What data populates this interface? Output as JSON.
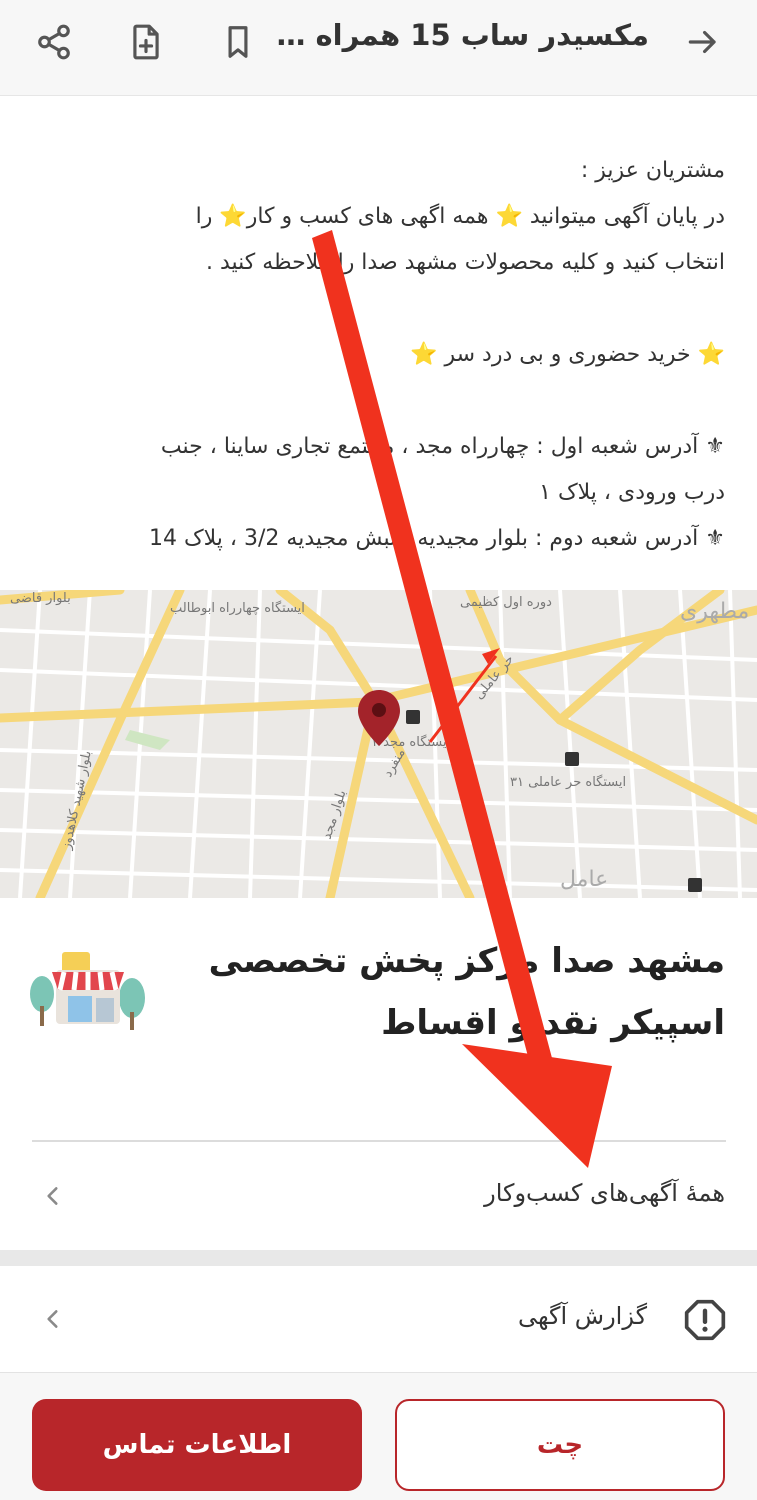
{
  "header": {
    "title": "مکسیدر ساب 15 همراه آ...",
    "back_icon": "arrow-right-icon",
    "bookmark_icon": "bookmark-icon",
    "note_icon": "note-add-icon",
    "share_icon": "share-icon"
  },
  "description": {
    "line1": "مشتریان عزیز :",
    "line2": "در پایان آگهی میتوانید ⭐ همه اگهی های کسب و کار⭐ را",
    "line3": "انتخاب کنید و کلیه محصولات مشهد صدا را ملاحظه کنید .",
    "line4": "⭐ خرید حضوری و بی درد سر ⭐",
    "line5": "⚜ آدرس شعبه اول : چهارراه مجد ، مجتمع تجاری ساینا ، جنب",
    "line6": "درب ورودی ، پلاک ۱",
    "line7": "⚜ آدرس شعبه دوم : بلوار مجیدیه ، نبش مجیدیه 3/2 ، پلاک 14"
  },
  "map": {
    "labels": {
      "l1": "بلوار قاضی",
      "l2": "ایستگاه چهارراه ابوطالب",
      "l3": "دوره اول کظیمی",
      "l4": "شهید مطهری",
      "l5": "حر عاملی",
      "l6": "ایستگاه مجد ۴",
      "l7": "بلوار شهید کلاهدوز",
      "l8": "ایستگاه حر عاملی ۳۱",
      "l9": "منفرد",
      "l10": "بلوار مجد",
      "l11": "عامل"
    },
    "pin_color": "#a3232a"
  },
  "business": {
    "name_line1": "مشهد صدا مرکز پخش تخصصی",
    "name_line2": "اسپیکر نقد و اقساط"
  },
  "links": {
    "all_ads": "همهٔ آگهی‌های کسب‌وکار",
    "report": "گزارش آگهی"
  },
  "buttons": {
    "contact": "اطلاعات تماس",
    "chat": "چت"
  },
  "colors": {
    "brand": "#b8262a",
    "overlay_arrow": "#f0321e"
  }
}
